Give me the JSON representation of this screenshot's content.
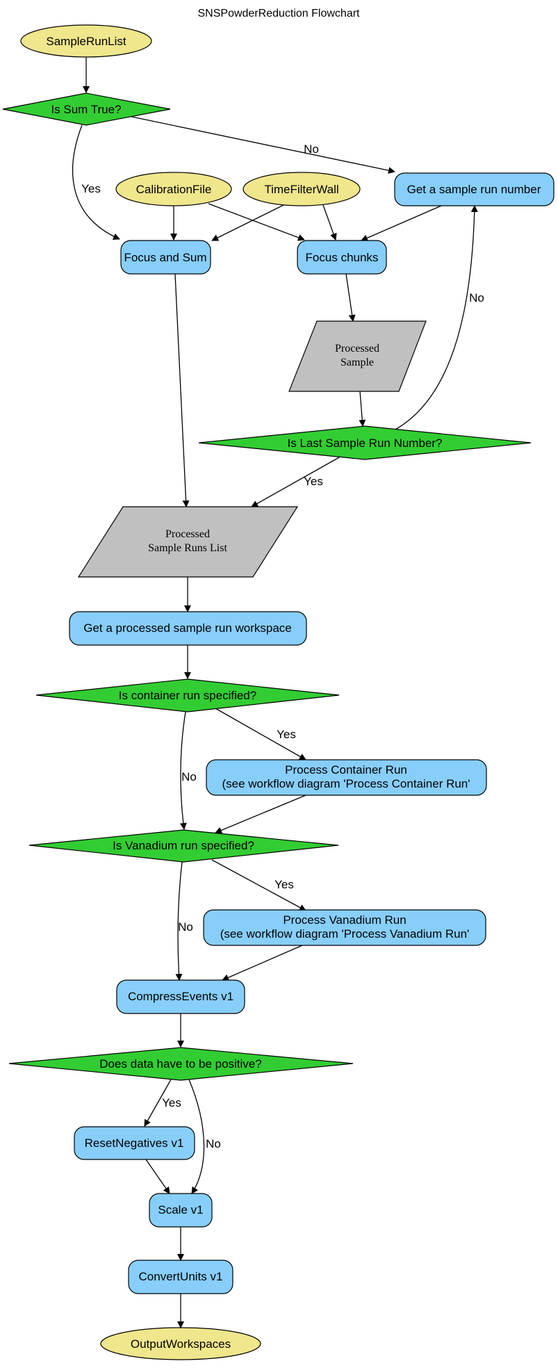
{
  "title": "SNSPowderReduction Flowchart",
  "colors": {
    "input": "#f0e68c",
    "process": "#87cefa",
    "decision": "#32cd32",
    "data": "#c0c0c0"
  },
  "nodes": {
    "sample_run_list": "SampleRunList",
    "is_sum_true": "Is Sum True?",
    "calibration_file": "CalibrationFile",
    "time_filter_wall": "TimeFilterWall",
    "get_sample_run_number": "Get a sample run number",
    "focus_and_sum": "Focus and Sum",
    "focus_chunks": "Focus chunks",
    "processed_sample": [
      "Processed",
      "Sample"
    ],
    "is_last_sample": "Is Last Sample Run Number?",
    "processed_sample_runs_list": [
      "Processed",
      "Sample Runs List"
    ],
    "get_processed_ws": "Get a processed sample run workspace",
    "is_container": "Is container run specified?",
    "process_container": [
      "Process Container Run",
      "(see workflow diagram 'Process Container Run'"
    ],
    "is_vanadium": "Is Vanadium run specified?",
    "process_vanadium": [
      "Process Vanadium Run",
      "(see workflow diagram 'Process Vanadium Run'"
    ],
    "compress_events": "CompressEvents v1",
    "is_positive": "Does data have to be positive?",
    "reset_negatives": "ResetNegatives v1",
    "scale": "Scale v1",
    "convert_units": "ConvertUnits v1",
    "output_workspaces": "OutputWorkspaces"
  },
  "edge_labels": {
    "sum_yes": "Yes",
    "sum_no": "No",
    "last_no": "No",
    "last_yes": "Yes",
    "container_yes": "Yes",
    "container_no": "No",
    "vanadium_yes": "Yes",
    "vanadium_no": "No",
    "positive_yes": "Yes",
    "positive_no": "No"
  }
}
